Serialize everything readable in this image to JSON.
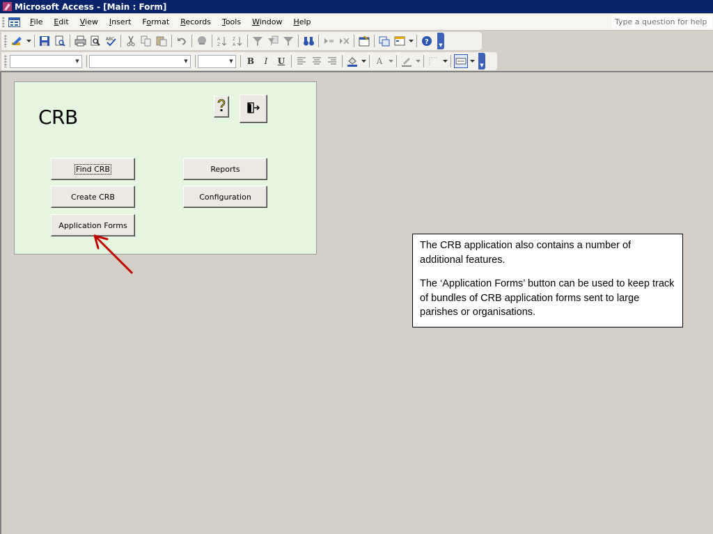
{
  "window": {
    "title": "Microsoft Access - [Main : Form]"
  },
  "menu": {
    "items": [
      {
        "label": "File",
        "key": "F",
        "rest": "ile"
      },
      {
        "label": "Edit",
        "key": "E",
        "rest": "dit"
      },
      {
        "label": "View",
        "key": "V",
        "rest": "iew"
      },
      {
        "label": "Insert",
        "key": "I",
        "rest": "nsert"
      },
      {
        "label": "Format",
        "pre": "F",
        "key": "o",
        "rest": "rmat"
      },
      {
        "label": "Records",
        "key": "R",
        "rest": "ecords"
      },
      {
        "label": "Tools",
        "key": "T",
        "rest": "ools"
      },
      {
        "label": "Window",
        "key": "W",
        "rest": "indow"
      },
      {
        "label": "Help",
        "key": "H",
        "rest": "elp"
      }
    ],
    "help_placeholder": "Type a question for help"
  },
  "toolbar_format": {
    "bold": "B",
    "italic": "I",
    "underline": "U",
    "font_color": "A"
  },
  "form": {
    "heading": "CRB",
    "buttons": {
      "find": "Find CRB",
      "create": "Create CRB",
      "application_forms": "Application Forms",
      "reports": "Reports",
      "configuration": "Configuration"
    }
  },
  "callout": {
    "paragraph1": "The CRB application also contains a number of additional features.",
    "paragraph2": "The ‘Application Forms’ button can be used to keep track of bundles of CRB application forms sent  to large parishes or organisations."
  },
  "colors": {
    "titlebar": "#0a246a",
    "form_background": "#e4f6e0",
    "workspace": "#d4d0c8",
    "arrow": "#c00000"
  }
}
